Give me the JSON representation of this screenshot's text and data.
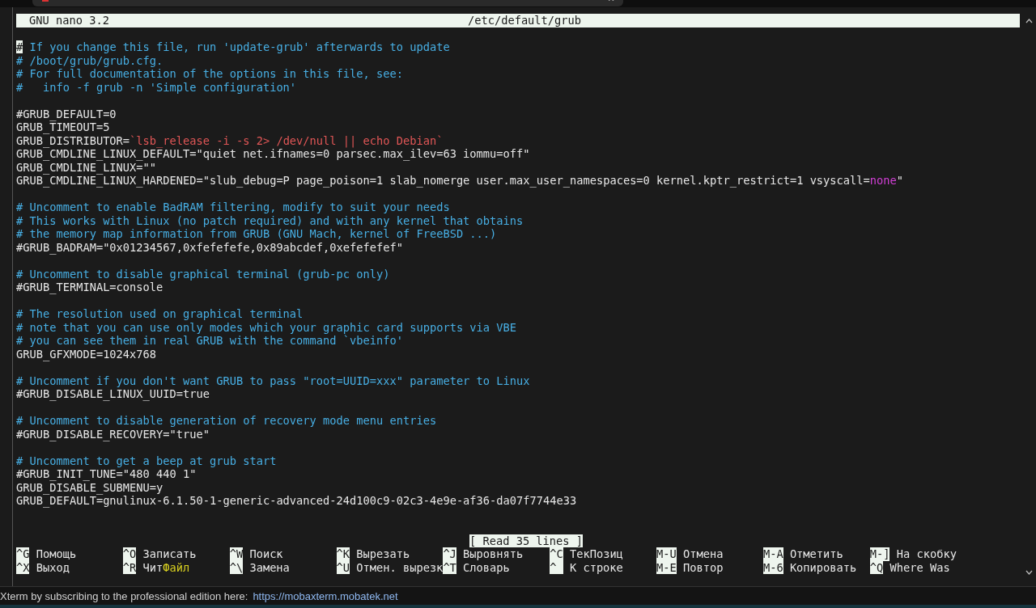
{
  "editor": {
    "app": "GNU nano 3.2",
    "file": "/etc/default/grub"
  },
  "lines": [
    {
      "kind": "code",
      "segments": [
        {
          "kind": "cursor",
          "text": "#"
        },
        {
          "kind": "comment",
          "text": " If you change this file, run 'update-grub' afterwards to update"
        }
      ]
    },
    {
      "kind": "code",
      "segments": [
        {
          "kind": "comment",
          "text": "# /boot/grub/grub.cfg."
        }
      ]
    },
    {
      "kind": "code",
      "segments": [
        {
          "kind": "comment",
          "text": "# For full documentation of the options in this file, see:"
        }
      ]
    },
    {
      "kind": "code",
      "segments": [
        {
          "kind": "comment",
          "text": "#   info -f grub -n 'Simple configuration'"
        }
      ]
    },
    {
      "kind": "blank"
    },
    {
      "kind": "code",
      "segments": [
        {
          "kind": "plain",
          "text": "#GRUB_DEFAULT=0"
        }
      ]
    },
    {
      "kind": "code",
      "segments": [
        {
          "kind": "plain",
          "text": "GRUB_TIMEOUT=5"
        }
      ]
    },
    {
      "kind": "code",
      "segments": [
        {
          "kind": "plain",
          "text": "GRUB_DISTRIBUTOR="
        },
        {
          "kind": "command",
          "text": "`lsb_release -i -s 2> /dev/null || echo Debian`"
        }
      ]
    },
    {
      "kind": "code",
      "segments": [
        {
          "kind": "plain",
          "text": "GRUB_CMDLINE_LINUX_DEFAULT=\"quiet net.ifnames=0 parsec.max_ilev=63 iommu=off\""
        }
      ]
    },
    {
      "kind": "code",
      "segments": [
        {
          "kind": "plain",
          "text": "GRUB_CMDLINE_LINUX=\"\""
        }
      ]
    },
    {
      "kind": "code",
      "segments": [
        {
          "kind": "plain",
          "text": "GRUB_CMDLINE_LINUX_HARDENED=\"slub_debug=P page_poison=1 slab_nomerge user.max_user_namespaces=0 kernel.kptr_restrict=1 vsyscall="
        },
        {
          "kind": "keyword",
          "text": "none"
        },
        {
          "kind": "plain",
          "text": "\""
        }
      ]
    },
    {
      "kind": "blank"
    },
    {
      "kind": "code",
      "segments": [
        {
          "kind": "comment",
          "text": "# Uncomment to enable BadRAM filtering, modify to suit your needs"
        }
      ]
    },
    {
      "kind": "code",
      "segments": [
        {
          "kind": "comment",
          "text": "# This works with Linux (no patch required) and with any kernel that obtains"
        }
      ]
    },
    {
      "kind": "code",
      "segments": [
        {
          "kind": "comment",
          "text": "# the memory map information from GRUB (GNU Mach, kernel of FreeBSD ...)"
        }
      ]
    },
    {
      "kind": "code",
      "segments": [
        {
          "kind": "plain",
          "text": "#GRUB_BADRAM=\"0x01234567,0xfefefefe,0x89abcdef,0xefefefef\""
        }
      ]
    },
    {
      "kind": "blank"
    },
    {
      "kind": "code",
      "segments": [
        {
          "kind": "comment",
          "text": "# Uncomment to disable graphical terminal (grub-pc only)"
        }
      ]
    },
    {
      "kind": "code",
      "segments": [
        {
          "kind": "plain",
          "text": "#GRUB_TERMINAL=console"
        }
      ]
    },
    {
      "kind": "blank"
    },
    {
      "kind": "code",
      "segments": [
        {
          "kind": "comment",
          "text": "# The resolution used on graphical terminal"
        }
      ]
    },
    {
      "kind": "code",
      "segments": [
        {
          "kind": "comment",
          "text": "# note that you can use only modes which your graphic card supports via VBE"
        }
      ]
    },
    {
      "kind": "code",
      "segments": [
        {
          "kind": "comment",
          "text": "# you can see them in real GRUB with the command `vbeinfo'"
        }
      ]
    },
    {
      "kind": "code",
      "segments": [
        {
          "kind": "plain",
          "text": "GRUB_GFXMODE=1024x768"
        }
      ]
    },
    {
      "kind": "blank"
    },
    {
      "kind": "code",
      "segments": [
        {
          "kind": "comment",
          "text": "# Uncomment if you don't want GRUB to pass \"root=UUID=xxx\" parameter to Linux"
        }
      ]
    },
    {
      "kind": "code",
      "segments": [
        {
          "kind": "plain",
          "text": "#GRUB_DISABLE_LINUX_UUID=true"
        }
      ]
    },
    {
      "kind": "blank"
    },
    {
      "kind": "code",
      "segments": [
        {
          "kind": "comment",
          "text": "# Uncomment to disable generation of recovery mode menu entries"
        }
      ]
    },
    {
      "kind": "code",
      "segments": [
        {
          "kind": "plain",
          "text": "#GRUB_DISABLE_RECOVERY=\"true\""
        }
      ]
    },
    {
      "kind": "blank"
    },
    {
      "kind": "code",
      "segments": [
        {
          "kind": "comment",
          "text": "# Uncomment to get a beep at grub start"
        }
      ]
    },
    {
      "kind": "code",
      "segments": [
        {
          "kind": "plain",
          "text": "#GRUB_INIT_TUNE=\"480 440 1\""
        }
      ]
    },
    {
      "kind": "code",
      "segments": [
        {
          "kind": "plain",
          "text": "GRUB_DISABLE_SUBMENU=y"
        }
      ]
    },
    {
      "kind": "code",
      "segments": [
        {
          "kind": "plain",
          "text": "GRUB_DEFAULT=gnulinux-6.1.50-1-generic-advanced-24d100c9-02c3-4e9e-af36-da07f7744e33"
        }
      ]
    }
  ],
  "status_message": "[ Read 35 lines ]",
  "shortcuts": [
    [
      {
        "key": "^G",
        "label": "Помощь"
      },
      {
        "key": "^O",
        "label": "Записать"
      },
      {
        "key": "^W",
        "label": "Поиск"
      },
      {
        "key": "^K",
        "label": "Вырезать"
      },
      {
        "key": "^J",
        "label": "Выровнять"
      },
      {
        "key": "^C",
        "label": "ТекПозиц"
      },
      {
        "key": "M-U",
        "label": "Отмена"
      },
      {
        "key": "M-A",
        "label": "Отметить"
      },
      {
        "key": "M-]",
        "label": "На скобку"
      }
    ],
    [
      {
        "key": "^X",
        "label": "Выход"
      },
      {
        "key": "^R",
        "label": "Чит",
        "accent": "Файл"
      },
      {
        "key": "^\\",
        "label": "Замена"
      },
      {
        "key": "^U",
        "label": "Отмен. вырезк"
      },
      {
        "key": "^T",
        "label": "Словарь"
      },
      {
        "key": "^",
        "label": "К строке"
      },
      {
        "key": "M-E",
        "label": "Повтор"
      },
      {
        "key": "M-6",
        "label": "Копировать"
      },
      {
        "key": "^Q",
        "label": "Where Was"
      }
    ]
  ],
  "status_bar": {
    "text": "Xterm by subscribing to the professional edition here:",
    "link": "https://mobaxterm.mobatek.net"
  }
}
